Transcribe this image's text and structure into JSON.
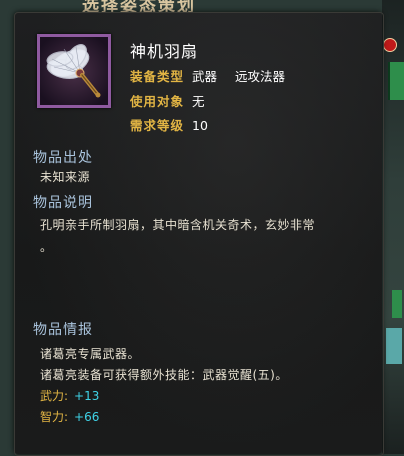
{
  "header": {
    "title": "选择姿态策划"
  },
  "item": {
    "name": "神机羽扇",
    "icon": "feather-fan-icon",
    "icon_border_color": "#8f5aa0",
    "stats": [
      {
        "label": "装备类型",
        "value": "武器",
        "value2": "远攻法器"
      },
      {
        "label": "使用对象",
        "value": "无"
      },
      {
        "label": "需求等级",
        "value": "10"
      }
    ]
  },
  "sections": {
    "origin": {
      "title": "物品出处",
      "text": "未知来源"
    },
    "description": {
      "title": "物品说明",
      "line1": "孔明亲手所制羽扇，其中暗含机关奇术，玄妙非常",
      "line2": "。"
    },
    "info": {
      "title": "物品情报",
      "line1": "诸葛亮专属武器。",
      "line2": "诸葛亮装备可获得额外技能：武器觉醒(五)。",
      "attributes": [
        {
          "label": "武力:",
          "value": "+13"
        },
        {
          "label": "智力:",
          "value": "+66"
        }
      ]
    }
  },
  "colors": {
    "section_title": "#a9c3dc",
    "stat_label": "#e2b544",
    "attr_value": "#3fd2e6"
  }
}
